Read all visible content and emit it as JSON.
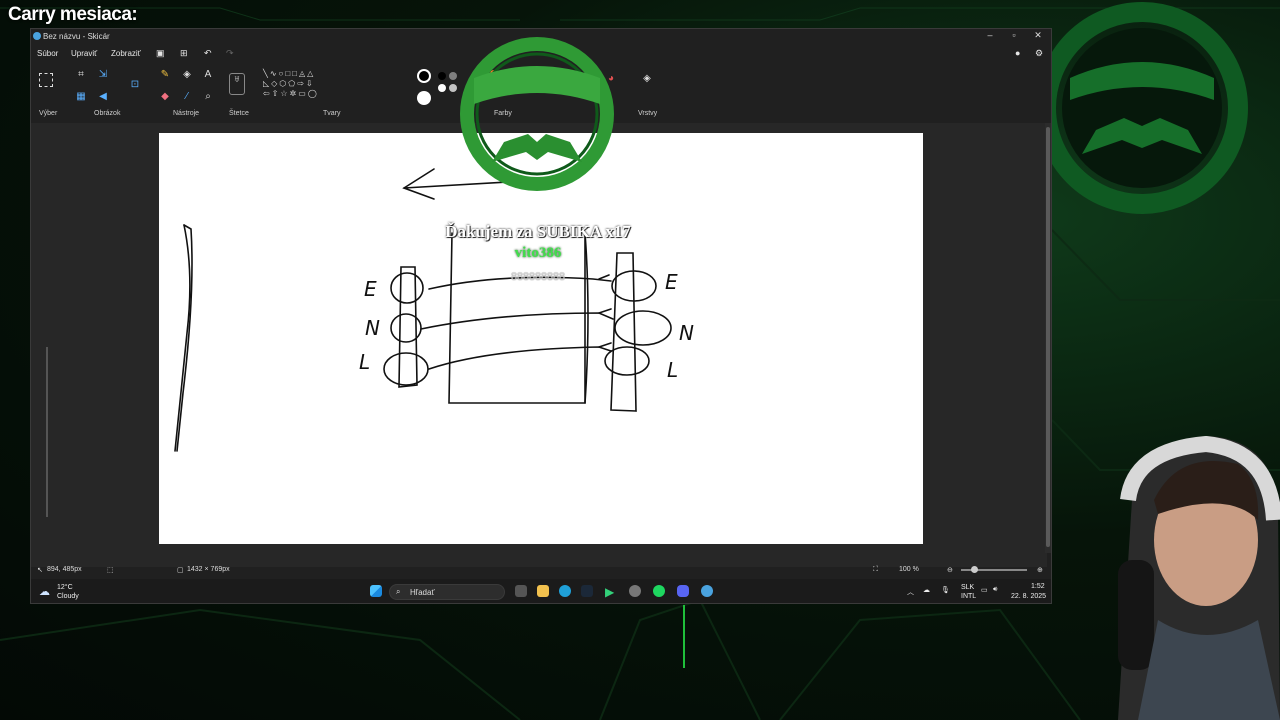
{
  "overlay": {
    "title": "Carry mesiaca:",
    "alert_text": "Ďakujem za SUBIKA x17",
    "alert_user": "vito386",
    "alert_sub": "888888888"
  },
  "window": {
    "title": "Bez názvu - Skicár",
    "menu": [
      "Súbor",
      "Upraviť",
      "Zobraziť"
    ],
    "ribbon_groups": [
      "Výber",
      "Obrázok",
      "Nástroje",
      "Štetce",
      "Tvary",
      "Farby",
      "Vrstvy"
    ],
    "status": {
      "cursor_pos": "894, 485px",
      "canvas_size": "1432 × 769px",
      "zoom": "100 %"
    }
  },
  "drawing": {
    "left_labels": [
      "E",
      "N",
      "L"
    ],
    "right_labels": [
      "E",
      "N",
      "L"
    ]
  },
  "taskbar": {
    "weather_temp": "12°C",
    "weather_desc": "Cloudy",
    "search_placeholder": "Hľadať",
    "lang_1": "SLK",
    "lang_2": "INTL",
    "time": "1:52",
    "date": "22. 8. 2025"
  },
  "colors": {
    "accent_green": "#1f8f2a",
    "bg_dark": "#061409"
  }
}
